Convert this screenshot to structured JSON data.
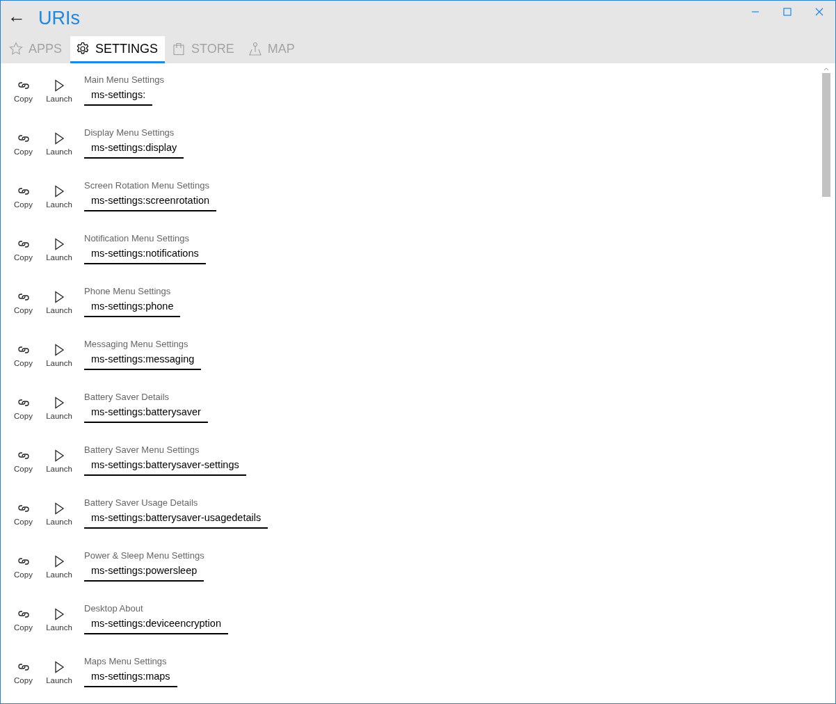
{
  "window": {
    "title": "URIs",
    "back": "←"
  },
  "tabs": [
    {
      "kind": "star",
      "label": "APPS",
      "selected": false
    },
    {
      "kind": "gear",
      "label": "SETTINGS",
      "selected": true
    },
    {
      "kind": "bag",
      "label": "STORE",
      "selected": false
    },
    {
      "kind": "map",
      "label": "MAP",
      "selected": false
    }
  ],
  "rows": [
    {
      "label": "Main Menu Settings",
      "value": "ms-settings:",
      "copy": "Copy",
      "launch": "Launch"
    },
    {
      "label": "Display Menu Settings",
      "value": "ms-settings:display",
      "copy": "Copy",
      "launch": "Launch"
    },
    {
      "label": "Screen Rotation Menu Settings",
      "value": "ms-settings:screenrotation",
      "copy": "Copy",
      "launch": "Launch"
    },
    {
      "label": "Notification Menu Settings",
      "value": "ms-settings:notifications",
      "copy": "Copy",
      "launch": "Launch"
    },
    {
      "label": "Phone Menu Settings",
      "value": "ms-settings:phone",
      "copy": "Copy",
      "launch": "Launch"
    },
    {
      "label": "Messaging Menu Settings",
      "value": "ms-settings:messaging",
      "copy": "Copy",
      "launch": "Launch"
    },
    {
      "label": "Battery Saver Details",
      "value": "ms-settings:batterysaver",
      "copy": "Copy",
      "launch": "Launch"
    },
    {
      "label": "Battery Saver Menu Settings",
      "value": "ms-settings:batterysaver-settings",
      "copy": "Copy",
      "launch": "Launch"
    },
    {
      "label": "Battery Saver Usage Details",
      "value": "ms-settings:batterysaver-usagedetails",
      "copy": "Copy",
      "launch": "Launch"
    },
    {
      "label": "Power & Sleep Menu Settings",
      "value": "ms-settings:powersleep",
      "copy": "Copy",
      "launch": "Launch"
    },
    {
      "label": "Desktop About",
      "value": "ms-settings:deviceencryption",
      "copy": "Copy",
      "launch": "Launch"
    },
    {
      "label": "Maps Menu Settings",
      "value": "ms-settings:maps",
      "copy": "Copy",
      "launch": "Launch"
    }
  ]
}
